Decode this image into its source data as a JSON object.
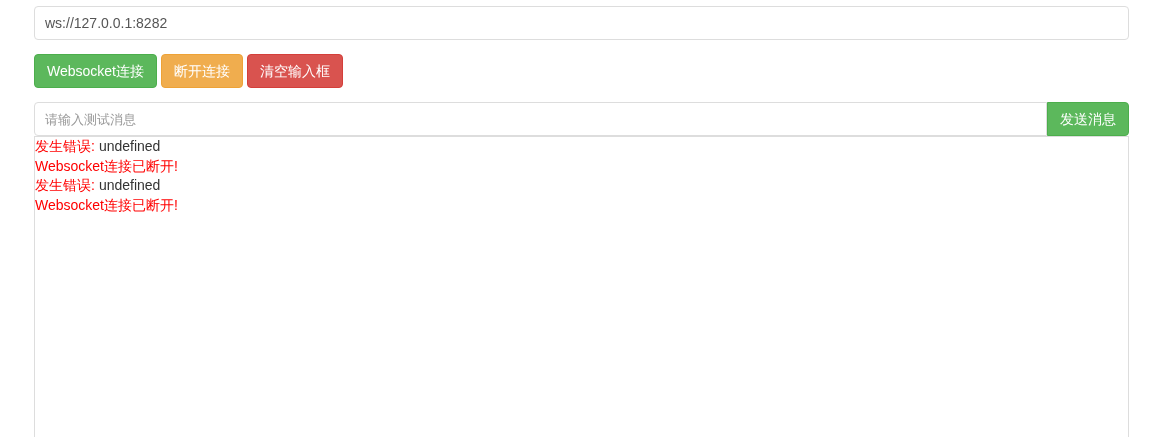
{
  "url_field": {
    "value": "ws://127.0.0.1:8282"
  },
  "buttons": [
    {
      "label": "Websocket连接",
      "kind": "success"
    },
    {
      "label": "断开连接",
      "kind": "warning"
    },
    {
      "label": "清空输入框",
      "kind": "danger"
    }
  ],
  "message_field": {
    "placeholder": "请输入测试消息"
  },
  "send_button": {
    "label": "发送消息"
  },
  "log": [
    {
      "kind": "error",
      "label": "发生错误:",
      "value": "undefined"
    },
    {
      "kind": "status",
      "text": "Websocket连接已断开!"
    },
    {
      "kind": "error",
      "label": "发生错误:",
      "value": "undefined"
    },
    {
      "kind": "status",
      "text": "Websocket连接已断开!"
    }
  ]
}
